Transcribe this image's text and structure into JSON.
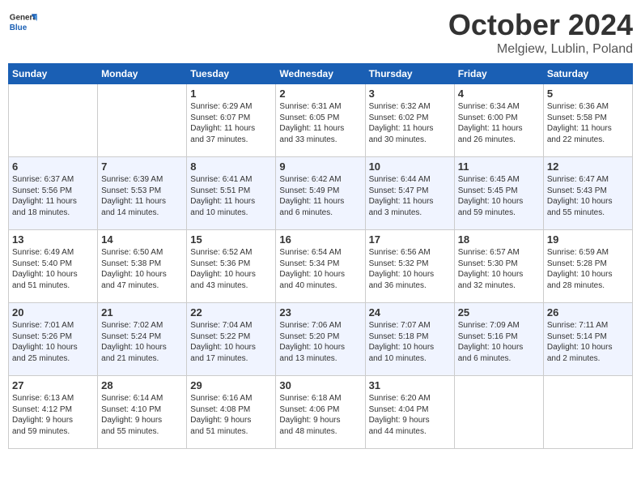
{
  "header": {
    "logo_general": "General",
    "logo_blue": "Blue",
    "month": "October 2024",
    "location": "Melgiew, Lublin, Poland"
  },
  "weekdays": [
    "Sunday",
    "Monday",
    "Tuesday",
    "Wednesday",
    "Thursday",
    "Friday",
    "Saturday"
  ],
  "weeks": [
    [
      {
        "day": "",
        "detail": ""
      },
      {
        "day": "",
        "detail": ""
      },
      {
        "day": "1",
        "detail": "Sunrise: 6:29 AM\nSunset: 6:07 PM\nDaylight: 11 hours\nand 37 minutes."
      },
      {
        "day": "2",
        "detail": "Sunrise: 6:31 AM\nSunset: 6:05 PM\nDaylight: 11 hours\nand 33 minutes."
      },
      {
        "day": "3",
        "detail": "Sunrise: 6:32 AM\nSunset: 6:02 PM\nDaylight: 11 hours\nand 30 minutes."
      },
      {
        "day": "4",
        "detail": "Sunrise: 6:34 AM\nSunset: 6:00 PM\nDaylight: 11 hours\nand 26 minutes."
      },
      {
        "day": "5",
        "detail": "Sunrise: 6:36 AM\nSunset: 5:58 PM\nDaylight: 11 hours\nand 22 minutes."
      }
    ],
    [
      {
        "day": "6",
        "detail": "Sunrise: 6:37 AM\nSunset: 5:56 PM\nDaylight: 11 hours\nand 18 minutes."
      },
      {
        "day": "7",
        "detail": "Sunrise: 6:39 AM\nSunset: 5:53 PM\nDaylight: 11 hours\nand 14 minutes."
      },
      {
        "day": "8",
        "detail": "Sunrise: 6:41 AM\nSunset: 5:51 PM\nDaylight: 11 hours\nand 10 minutes."
      },
      {
        "day": "9",
        "detail": "Sunrise: 6:42 AM\nSunset: 5:49 PM\nDaylight: 11 hours\nand 6 minutes."
      },
      {
        "day": "10",
        "detail": "Sunrise: 6:44 AM\nSunset: 5:47 PM\nDaylight: 11 hours\nand 3 minutes."
      },
      {
        "day": "11",
        "detail": "Sunrise: 6:45 AM\nSunset: 5:45 PM\nDaylight: 10 hours\nand 59 minutes."
      },
      {
        "day": "12",
        "detail": "Sunrise: 6:47 AM\nSunset: 5:43 PM\nDaylight: 10 hours\nand 55 minutes."
      }
    ],
    [
      {
        "day": "13",
        "detail": "Sunrise: 6:49 AM\nSunset: 5:40 PM\nDaylight: 10 hours\nand 51 minutes."
      },
      {
        "day": "14",
        "detail": "Sunrise: 6:50 AM\nSunset: 5:38 PM\nDaylight: 10 hours\nand 47 minutes."
      },
      {
        "day": "15",
        "detail": "Sunrise: 6:52 AM\nSunset: 5:36 PM\nDaylight: 10 hours\nand 43 minutes."
      },
      {
        "day": "16",
        "detail": "Sunrise: 6:54 AM\nSunset: 5:34 PM\nDaylight: 10 hours\nand 40 minutes."
      },
      {
        "day": "17",
        "detail": "Sunrise: 6:56 AM\nSunset: 5:32 PM\nDaylight: 10 hours\nand 36 minutes."
      },
      {
        "day": "18",
        "detail": "Sunrise: 6:57 AM\nSunset: 5:30 PM\nDaylight: 10 hours\nand 32 minutes."
      },
      {
        "day": "19",
        "detail": "Sunrise: 6:59 AM\nSunset: 5:28 PM\nDaylight: 10 hours\nand 28 minutes."
      }
    ],
    [
      {
        "day": "20",
        "detail": "Sunrise: 7:01 AM\nSunset: 5:26 PM\nDaylight: 10 hours\nand 25 minutes."
      },
      {
        "day": "21",
        "detail": "Sunrise: 7:02 AM\nSunset: 5:24 PM\nDaylight: 10 hours\nand 21 minutes."
      },
      {
        "day": "22",
        "detail": "Sunrise: 7:04 AM\nSunset: 5:22 PM\nDaylight: 10 hours\nand 17 minutes."
      },
      {
        "day": "23",
        "detail": "Sunrise: 7:06 AM\nSunset: 5:20 PM\nDaylight: 10 hours\nand 13 minutes."
      },
      {
        "day": "24",
        "detail": "Sunrise: 7:07 AM\nSunset: 5:18 PM\nDaylight: 10 hours\nand 10 minutes."
      },
      {
        "day": "25",
        "detail": "Sunrise: 7:09 AM\nSunset: 5:16 PM\nDaylight: 10 hours\nand 6 minutes."
      },
      {
        "day": "26",
        "detail": "Sunrise: 7:11 AM\nSunset: 5:14 PM\nDaylight: 10 hours\nand 2 minutes."
      }
    ],
    [
      {
        "day": "27",
        "detail": "Sunrise: 6:13 AM\nSunset: 4:12 PM\nDaylight: 9 hours\nand 59 minutes."
      },
      {
        "day": "28",
        "detail": "Sunrise: 6:14 AM\nSunset: 4:10 PM\nDaylight: 9 hours\nand 55 minutes."
      },
      {
        "day": "29",
        "detail": "Sunrise: 6:16 AM\nSunset: 4:08 PM\nDaylight: 9 hours\nand 51 minutes."
      },
      {
        "day": "30",
        "detail": "Sunrise: 6:18 AM\nSunset: 4:06 PM\nDaylight: 9 hours\nand 48 minutes."
      },
      {
        "day": "31",
        "detail": "Sunrise: 6:20 AM\nSunset: 4:04 PM\nDaylight: 9 hours\nand 44 minutes."
      },
      {
        "day": "",
        "detail": ""
      },
      {
        "day": "",
        "detail": ""
      }
    ]
  ]
}
